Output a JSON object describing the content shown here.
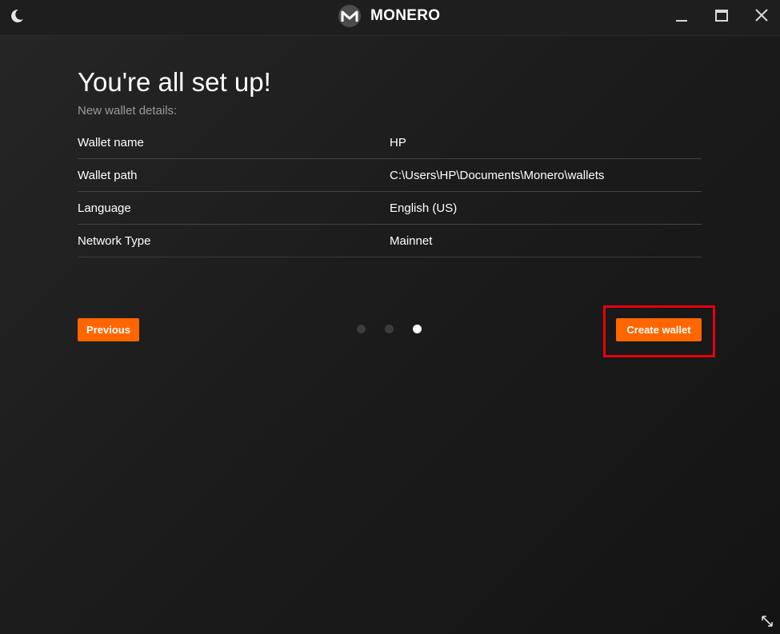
{
  "app": {
    "name": "MONERO",
    "logo_icon": "monero-logo-icon",
    "theme_icon": "moon-icon"
  },
  "window_controls": {
    "minimize_icon": "minimize-icon",
    "maximize_icon": "maximize-icon",
    "close_icon": "close-icon"
  },
  "page": {
    "title": "You're all set up!",
    "subtitle": "New wallet details:"
  },
  "details": [
    {
      "label": "Wallet name",
      "value": "HP"
    },
    {
      "label": "Wallet path",
      "value": "C:\\Users\\HP\\Documents\\Monero\\wallets"
    },
    {
      "label": "Language",
      "value": "English (US)"
    },
    {
      "label": "Network Type",
      "value": "Mainnet"
    }
  ],
  "navigation": {
    "previous_label": "Previous",
    "create_label": "Create wallet",
    "steps_total": 3,
    "current_step": 3
  },
  "colors": {
    "accent": "#ff6600",
    "highlight": "#e8000b",
    "background": "#1c1c1c"
  }
}
